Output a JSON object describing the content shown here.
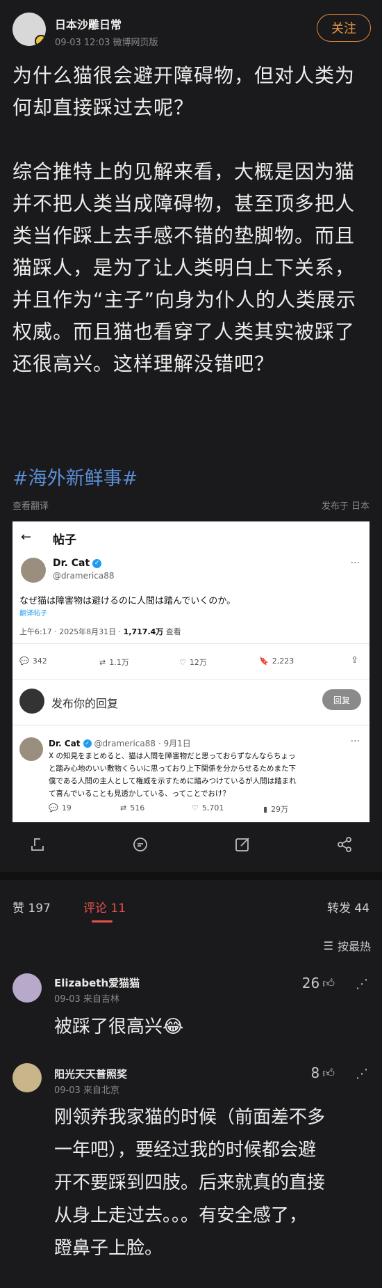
{
  "post": {
    "author": "日本沙雕日常",
    "meta": "09-03 12:03  微博网页版",
    "follow_label": "关注",
    "text_lines": [
      "为什么猫很会避开障碍物，但对人类为",
      "何却直接踩过去呢？",
      "",
      "综合推特上的见解来看，大概是因为猫",
      "并不把人类当成障碍物，甚至顶多把人",
      "类当作踩上去手感不错的垫脚物。而且",
      "猫踩人，是为了让人类明白上下关系，",
      "并且作为“主子”向身为仆人的人类展示",
      "权威。而且猫也看穿了人类其实被踩了",
      "还很高兴。这样理解没错吧？"
    ],
    "topic": "#海外新鲜事#",
    "view_translation": "查看翻译",
    "published_in": "发布于 日本"
  },
  "embed": {
    "header_title": "帖子",
    "name": "Dr. Cat",
    "handle": "@dramerica88",
    "tweet": "なぜ猫は障害物は避けるのに人間は踏んでいくのか。",
    "translate": "翻译帖子",
    "time": "上午6:17 · 2025年8月31日 · ",
    "views": "1,717.4万",
    "views_label": " 查看",
    "stats": {
      "replies": "342",
      "retweets": "1.1万",
      "likes": "12万",
      "bookmarks": "2,223"
    },
    "reply_placeholder": "发布你的回复",
    "reply_button": "回复",
    "reply": {
      "name": "Dr. Cat",
      "handle": "@dramerica88 · 9月1日",
      "lines": [
        "X の知見をまとめると、猫は人間を障害物だと思っておらずなんならちょっ",
        "と踏み心地のいい敷物くらいに思っており上下関係を分からせるためまた下",
        "僕である人間の主人として権威を示すために踏みつけているが人間は踏まれ",
        "て喜んでいることも見透かしている、ってことでおけ？"
      ],
      "stats": {
        "replies": "19",
        "retweets": "516",
        "likes": "5,701",
        "views": "29万"
      }
    }
  },
  "tabs": {
    "likes_label": "赞",
    "likes_count": "197",
    "comments_label": "评论",
    "comments_count": "11",
    "reposts_label": "转发",
    "reposts_count": "44",
    "sort_label": "按最热"
  },
  "comments": [
    {
      "name": "Elizabeth爱猫猫",
      "meta": "09-03  来自吉林",
      "likes": "26",
      "lines": [
        "被踩了很高兴😂"
      ]
    },
    {
      "name": "阳光天天普照奖",
      "meta": "09-03  来自北京",
      "likes": "8",
      "lines": [
        "刚领养我家猫的时候（前面差不多",
        "一年吧），要经过我的时候都会避",
        "开不要踩到四肢。后来就真的直接",
        "从身上走过去。。。有安全感了，",
        "蹬鼻子上脸。"
      ]
    }
  ]
}
